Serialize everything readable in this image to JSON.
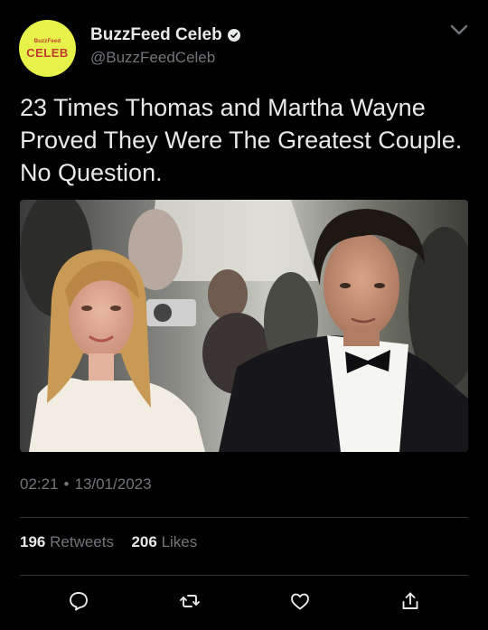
{
  "author": {
    "avatar_brand_top": "BuzzFeed",
    "avatar_brand_main": "CELEB",
    "display_name": "BuzzFeed Celeb",
    "handle": "@BuzzFeedCeleb",
    "verified": true
  },
  "tweet": {
    "text": "23 Times Thomas and Martha Wayne Proved They Were The Greatest Couple. No Question.",
    "time": "02:21",
    "separator": "•",
    "date": "13/01/2023"
  },
  "stats": {
    "retweets_count": "196",
    "retweets_label": "Retweets",
    "likes_count": "206",
    "likes_label": "Likes"
  },
  "actions": {
    "reply_icon": "speech-bubble-icon",
    "retweet_icon": "retweet-arrows-icon",
    "like_icon": "heart-icon",
    "share_icon": "share-upload-icon"
  },
  "colors": {
    "background": "#000000",
    "text_primary": "#e7e9ea",
    "text_secondary": "#71767b",
    "divider": "#2f3336",
    "avatar_bg": "#e6f24a",
    "avatar_text": "#c13a30"
  }
}
